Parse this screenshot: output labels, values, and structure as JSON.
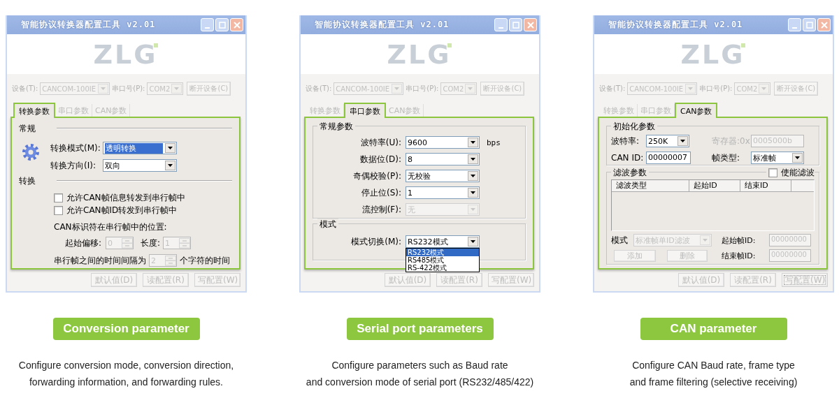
{
  "panels": [
    {
      "window": {
        "title": "智能协议转换器配置工具 v2.01",
        "logo": "ZLG",
        "device": {
          "label": "设备(T):",
          "value": "CANCOM-100IE",
          "port_label": "串口号(P):",
          "port_value": "COM2",
          "button": "断开设备(C)"
        },
        "tabs": [
          {
            "label": "转换参数",
            "selected": true
          },
          {
            "label": "串口参数",
            "selected": false
          },
          {
            "label": "CAN参数",
            "selected": false
          }
        ],
        "content": {
          "kind": "conversion",
          "general_title": "常规",
          "fields": [
            {
              "label": "转换模式(M):",
              "value": "透明转换",
              "highlighted": true
            },
            {
              "label": "转换方向(I):",
              "value": "双向",
              "highlighted": false
            }
          ],
          "conversion_title": "转换",
          "checks": [
            {
              "label": "允许CAN帧信息转发到串行帧中",
              "checked": false
            },
            {
              "label": "允许CAN帧ID转发到串行帧中",
              "checked": false
            }
          ],
          "position_label": "CAN标识符在串行帧中的位置:",
          "offset": {
            "label": "起始偏移:",
            "value": "0",
            "disabled": true
          },
          "length": {
            "label": "长度:",
            "value": "1",
            "disabled": true
          },
          "interval": {
            "before": "串行帧之间的时间间隔为",
            "value": "2",
            "disabled": true,
            "after": "个字符的时间"
          }
        },
        "buttons": [
          {
            "label": "默认值(D)",
            "focused": false
          },
          {
            "label": "读配置(R)",
            "focused": false
          },
          {
            "label": "写配置(W)",
            "focused": false
          }
        ]
      },
      "caption": "Conversion parameter",
      "description": "Configure conversion mode, conversion direction,\nforwarding information, and forwarding rules."
    },
    {
      "window": {
        "title": "智能协议转换器配置工具 v2.01",
        "logo": "ZLG",
        "device": {
          "label": "设备(T):",
          "value": "CANCOM-100IE",
          "port_label": "串口号(P):",
          "port_value": "COM2",
          "button": "断开设备(C)"
        },
        "tabs": [
          {
            "label": "转换参数",
            "selected": false
          },
          {
            "label": "串口参数",
            "selected": true
          },
          {
            "label": "CAN参数",
            "selected": false
          }
        ],
        "content": {
          "kind": "serial",
          "general_title": "常规参数",
          "fields": [
            {
              "label": "波特率(U):",
              "value": "9600",
              "unit": "bps",
              "disabled": false
            },
            {
              "label": "数据位(D):",
              "value": "8",
              "disabled": false
            },
            {
              "label": "奇偶校验(P):",
              "value": "无校验",
              "disabled": false
            },
            {
              "label": "停止位(S):",
              "value": "1",
              "disabled": false
            },
            {
              "label": "流控制(F):",
              "value": "无",
              "disabled": true
            }
          ],
          "mode_title": "模式",
          "mode": {
            "label": "模式切换(M):",
            "value": "RS232模式",
            "options": [
              {
                "label": "RS232模式",
                "selected": true
              },
              {
                "label": "RS485模式",
                "selected": false
              },
              {
                "label": "RS-422模式",
                "selected": false
              }
            ]
          }
        },
        "buttons": [
          {
            "label": "默认值(D)",
            "focused": false
          },
          {
            "label": "读配置(R)",
            "focused": false
          },
          {
            "label": "写配置(W)",
            "focused": false
          }
        ]
      },
      "caption": "Serial port parameters",
      "description": "Configure parameters such as Baud rate\nand conversion mode of serial port (RS232/485/422)"
    },
    {
      "window": {
        "title": "智能协议转换器配置工具 v2.01",
        "logo": "ZLG",
        "device": {
          "label": "设备(T):",
          "value": "CANCOM-100IE",
          "port_label": "串口号(P):",
          "port_value": "COM2",
          "button": "断开设备(C)"
        },
        "tabs": [
          {
            "label": "转换参数",
            "selected": false
          },
          {
            "label": "串口参数",
            "selected": false
          },
          {
            "label": "CAN参数",
            "selected": true
          }
        ],
        "content": {
          "kind": "can",
          "init_title": "初始化参数",
          "baud": {
            "label": "波特率:",
            "value": "250K"
          },
          "register": {
            "label": "寄存器:0x",
            "value": "0005000b",
            "disabled": true
          },
          "can_id": {
            "label": "CAN ID:",
            "value": "00000007",
            "disabled": false
          },
          "frame_type": {
            "label": "帧类型:",
            "value": "标准帧"
          },
          "filter_title": "滤波参数",
          "enable": {
            "label": "使能滤波",
            "checked": false
          },
          "columns": [
            "滤波类型",
            "起始ID",
            "结束ID"
          ],
          "mode": {
            "label": "模式",
            "value": "标准帧单ID滤波",
            "disabled": true
          },
          "add": "添加",
          "delete": "删除",
          "start": {
            "label": "起始帧ID:",
            "value": "00000000",
            "disabled": true
          },
          "end": {
            "label": "结束帧ID:",
            "value": "00000000",
            "disabled": true
          }
        },
        "buttons": [
          {
            "label": "默认值(D)",
            "focused": false
          },
          {
            "label": "读配置(R)",
            "focused": false
          },
          {
            "label": "写配置(W)",
            "focused": true
          }
        ]
      },
      "caption": "CAN parameter",
      "description": "Configure CAN Baud rate, frame type\nand frame filtering (selective receiving)"
    }
  ]
}
